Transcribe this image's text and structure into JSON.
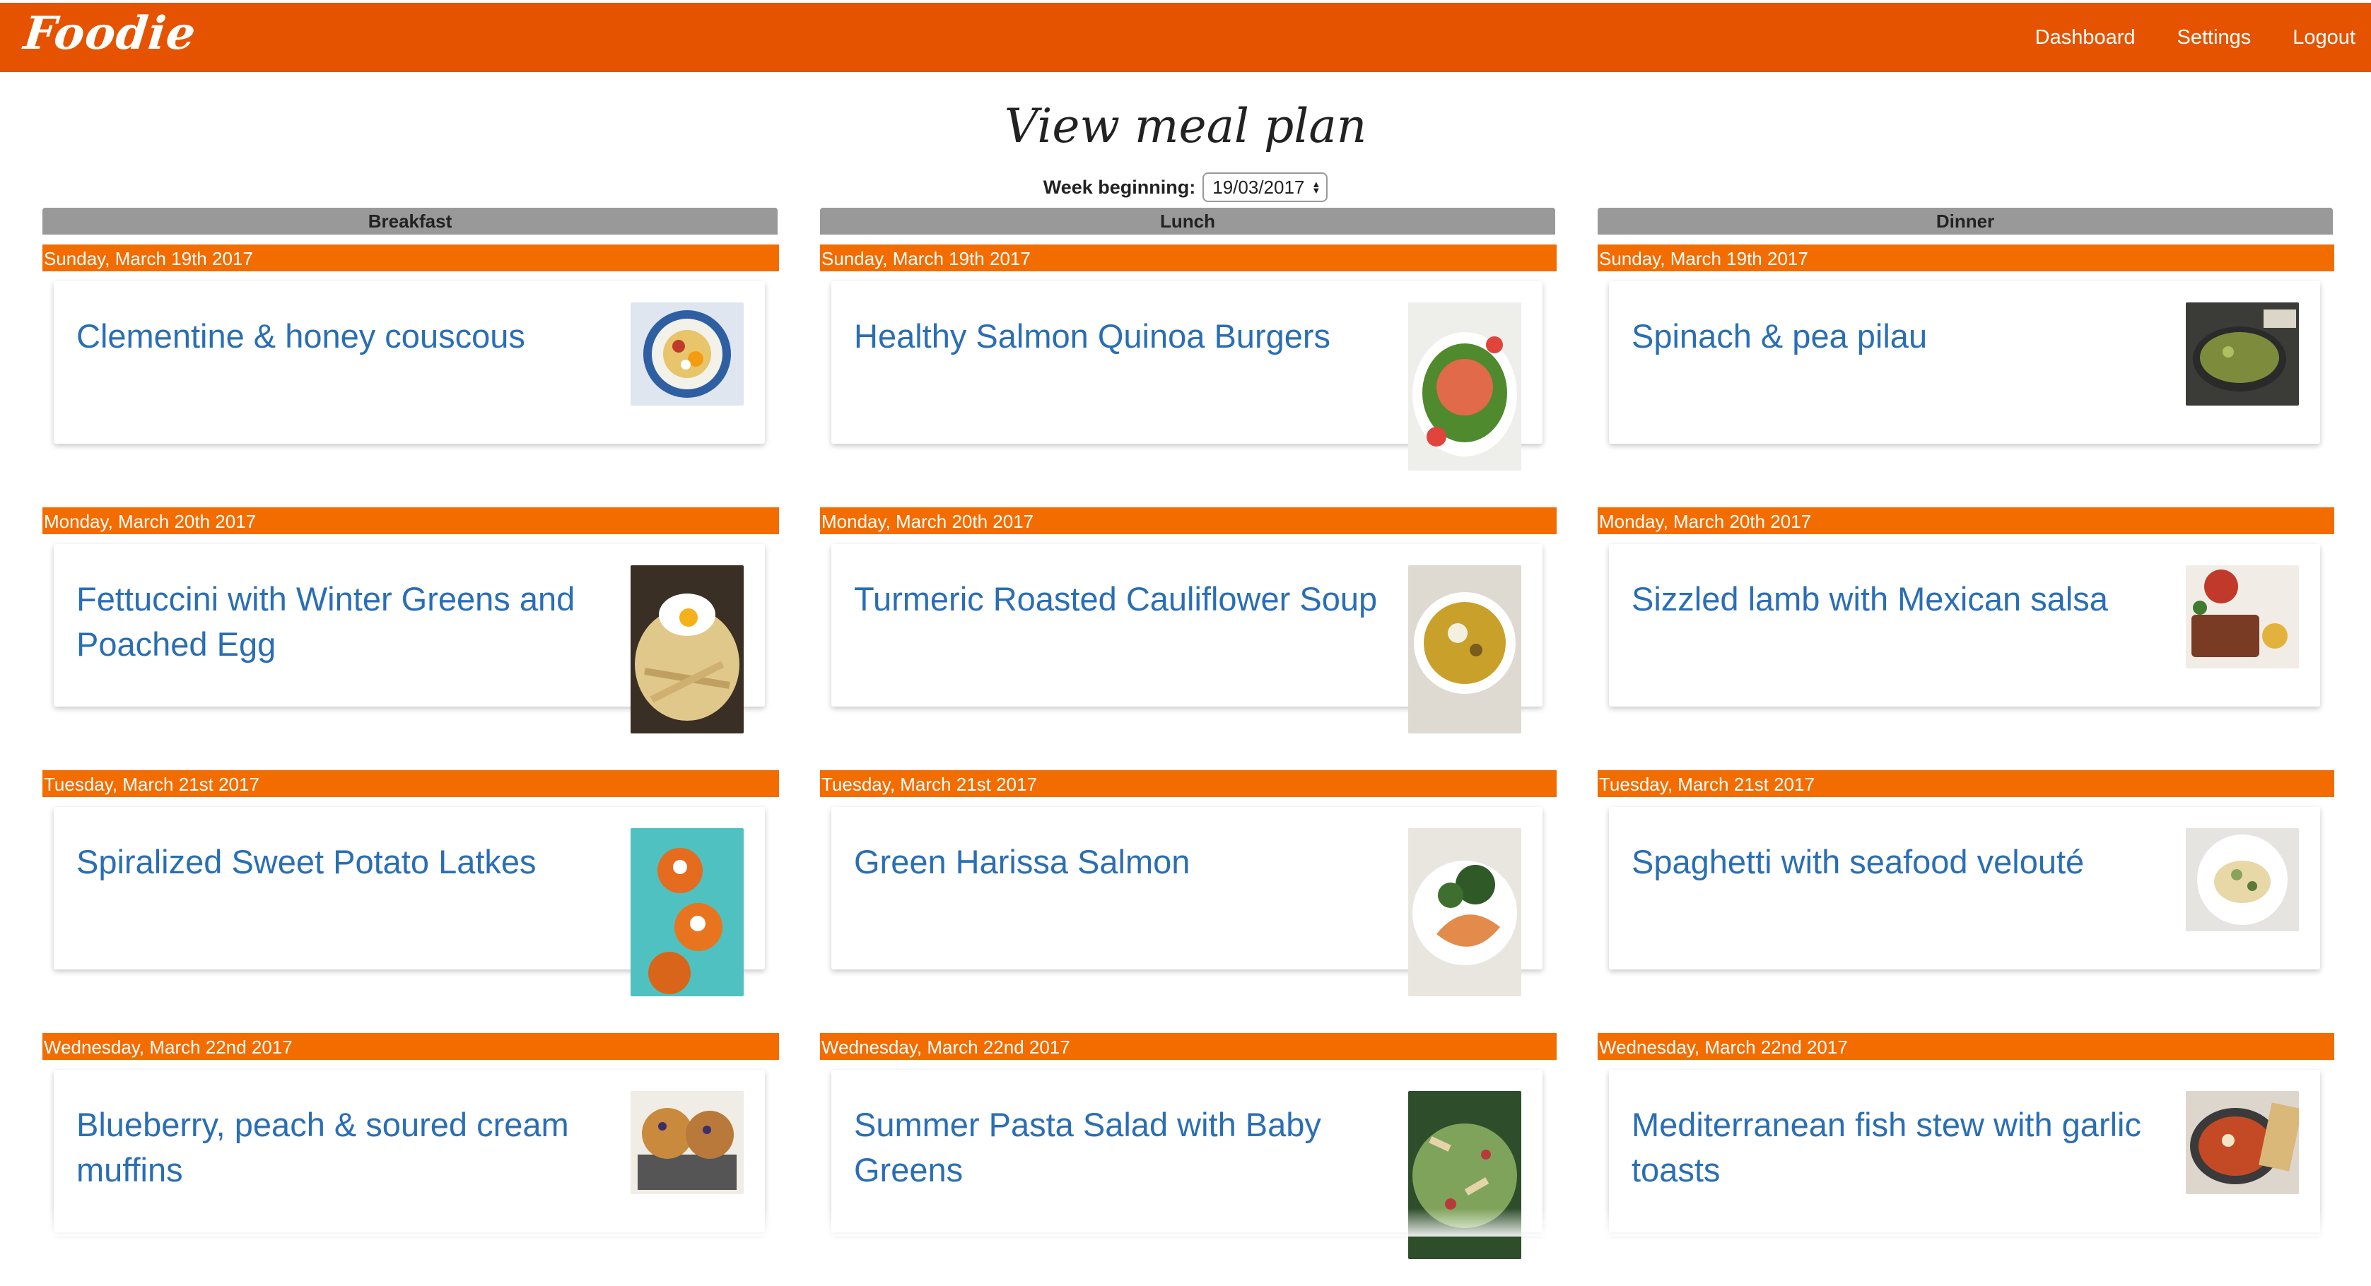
{
  "nav": {
    "brand": "Foodie",
    "links": [
      "Dashboard",
      "Settings",
      "Logout"
    ]
  },
  "page": {
    "title": "View meal plan",
    "week_label": "Week beginning:",
    "week_value": "19/03/2017"
  },
  "columns": [
    {
      "header": "Breakfast",
      "days": [
        {
          "date": "Sunday, March 19th 2017",
          "recipe": "Clementine & honey couscous",
          "image_icon": "couscous-bowl-image"
        },
        {
          "date": "Monday, March 20th 2017",
          "recipe": "Fettuccini with Winter Greens and Poached Egg",
          "image_icon": "fettuccini-image"
        },
        {
          "date": "Tuesday, March 21st 2017",
          "recipe": "Spiralized Sweet Potato Latkes",
          "image_icon": "latkes-image"
        },
        {
          "date": "Wednesday, March 22nd 2017",
          "recipe": "Blueberry, peach & soured cream muffins",
          "image_icon": "muffins-image"
        }
      ]
    },
    {
      "header": "Lunch",
      "days": [
        {
          "date": "Sunday, March 19th 2017",
          "recipe": "Healthy Salmon Quinoa Burgers",
          "image_icon": "salmon-burger-image"
        },
        {
          "date": "Monday, March 20th 2017",
          "recipe": "Turmeric Roasted Cauliflower Soup",
          "image_icon": "soup-bowl-image"
        },
        {
          "date": "Tuesday, March 21st 2017",
          "recipe": "Green Harissa Salmon",
          "image_icon": "harissa-salmon-image"
        },
        {
          "date": "Wednesday, March 22nd 2017",
          "recipe": "Summer Pasta Salad with Baby Greens",
          "image_icon": "pasta-salad-image"
        }
      ]
    },
    {
      "header": "Dinner",
      "days": [
        {
          "date": "Sunday, March 19th 2017",
          "recipe": "Spinach & pea pilau",
          "image_icon": "pilau-pan-image"
        },
        {
          "date": "Monday, March 20th 2017",
          "recipe": "Sizzled lamb with Mexican salsa",
          "image_icon": "lamb-salsa-image"
        },
        {
          "date": "Tuesday, March 21st 2017",
          "recipe": "Spaghetti with seafood velouté",
          "image_icon": "spaghetti-image"
        },
        {
          "date": "Wednesday, March 22nd 2017",
          "recipe": "Mediterranean fish stew with garlic toasts",
          "image_icon": "fish-stew-image"
        }
      ]
    }
  ],
  "colors": {
    "navbar": "#e55300",
    "day_bar": "#f26c00",
    "column_header": "#999999",
    "link": "#2a6eb4"
  }
}
